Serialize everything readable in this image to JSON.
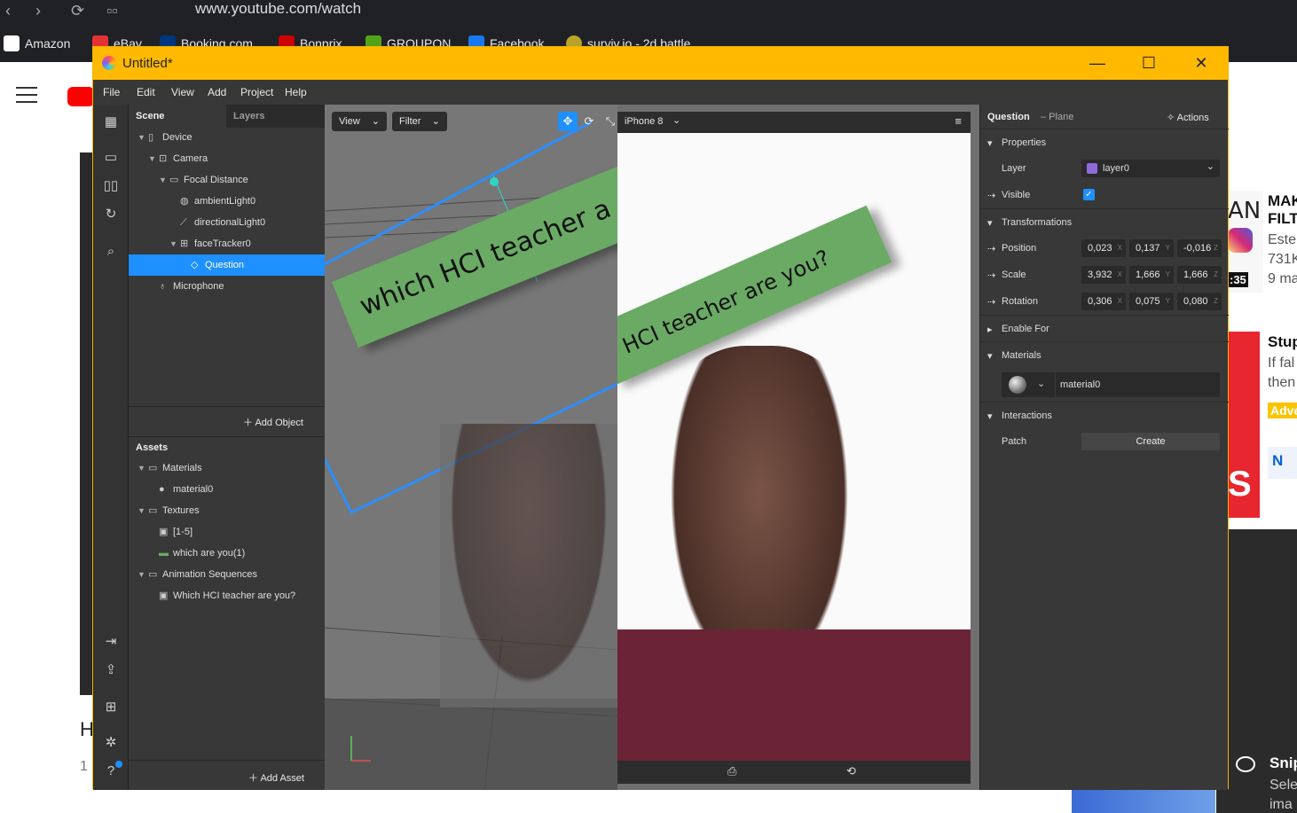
{
  "browser": {
    "url": "www.youtube.com/watch",
    "bookmarks": [
      "Amazon",
      "eBay",
      "Booking.com",
      "Bonprix",
      "GROUPON",
      "Facebook",
      "surviv.io - 2d battle"
    ]
  },
  "youtube": {
    "left_title": "H",
    "left_sub": "1",
    "recs": [
      {
        "thumb_text": "AN",
        "title": "MAK",
        "title2": "FILT",
        "meta1": "Este",
        "meta2": "731K",
        "meta3": "9 ma",
        "duration": ":35"
      },
      {
        "title": "Stup",
        "meta1": "If fal",
        "meta2": "then",
        "badge": "Adve"
      },
      {
        "button": "N"
      }
    ],
    "snip": {
      "title": "Snip",
      "line1": "Sele",
      "line2": "ima"
    }
  },
  "app": {
    "title": "Untitled*",
    "menu": [
      "File",
      "Edit",
      "View",
      "Add",
      "Project",
      "Help"
    ],
    "scene_tabs": [
      "Scene",
      "Layers"
    ],
    "scene_tree": [
      {
        "label": "Device",
        "icon": "device"
      },
      {
        "label": "Camera",
        "icon": "camera"
      },
      {
        "label": "Focal Distance",
        "icon": "focal"
      },
      {
        "label": "ambientLight0",
        "icon": "light"
      },
      {
        "label": "directionalLight0",
        "icon": "dirlight"
      },
      {
        "label": "faceTracker0",
        "icon": "tracker"
      },
      {
        "label": "Question",
        "icon": "plane"
      },
      {
        "label": "Microphone",
        "icon": "mic"
      }
    ],
    "add_object": "Add Object",
    "assets_header": "Assets",
    "assets_tree": [
      {
        "label": "Materials"
      },
      {
        "label": "material0"
      },
      {
        "label": "Textures"
      },
      {
        "label": "[1-5]"
      },
      {
        "label": "which are you(1)"
      },
      {
        "label": "Animation Sequences"
      },
      {
        "label": "Which HCI teacher are you?"
      }
    ],
    "add_asset": "Add Asset",
    "viewport": {
      "view_btn": "View",
      "filter_btn": "Filter",
      "device": "iPhone 8",
      "banner_text_left": "which HCI teacher a",
      "banner_text_right": "HCI teacher are you?"
    },
    "props": {
      "object_name": "Question",
      "object_type": "– Plane",
      "actions": "Actions",
      "properties": "Properties",
      "layer_label": "Layer",
      "layer_value": "layer0",
      "visible_label": "Visible",
      "transformations": "Transformations",
      "position_label": "Position",
      "position": [
        "0,023",
        "0,137",
        "-0,016"
      ],
      "scale_label": "Scale",
      "scale": [
        "3,932",
        "1,666",
        "1,666"
      ],
      "rotation_label": "Rotation",
      "rotation": [
        "0,306",
        "0,075",
        "0,080"
      ],
      "axes": [
        "X",
        "Y",
        "Z"
      ],
      "enable_for": "Enable For",
      "materials": "Materials",
      "material_value": "material0",
      "interactions": "Interactions",
      "patch_label": "Patch",
      "create_btn": "Create"
    }
  }
}
